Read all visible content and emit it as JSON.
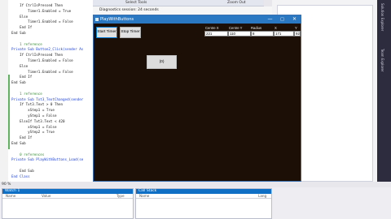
{
  "editor": {
    "lines": [
      {
        "text": "    If CtrlIsPressed Then",
        "cls": ""
      },
      {
        "text": "        Timer1.Enabled = True",
        "cls": ""
      },
      {
        "text": "    Else",
        "cls": ""
      },
      {
        "text": "        Timer1.Enabled = False",
        "cls": ""
      },
      {
        "text": "    End If",
        "cls": ""
      },
      {
        "text": "End Sub",
        "cls": ""
      },
      {
        "text": "",
        "cls": ""
      },
      {
        "text": "    1 reference",
        "cls": "cm"
      },
      {
        "text": "Private Sub Button2_Click(sender As",
        "cls": "kw"
      },
      {
        "text": "    If CtrlIsPressed Then",
        "cls": ""
      },
      {
        "text": "        Timer1.Enabled = False",
        "cls": ""
      },
      {
        "text": "    Else",
        "cls": ""
      },
      {
        "text": "        Timer1.Enabled = False",
        "cls": ""
      },
      {
        "text": "    End If",
        "cls": ""
      },
      {
        "text": "End Sub",
        "cls": ""
      },
      {
        "text": "",
        "cls": ""
      },
      {
        "text": "    1 reference",
        "cls": "cm"
      },
      {
        "text": "Private Sub Txt3_TextChanged(sender",
        "cls": "kw"
      },
      {
        "text": "    If Txt3.Text > 0 Then",
        "cls": ""
      },
      {
        "text": "        xStep1 = True",
        "cls": ""
      },
      {
        "text": "        yStep1 = False",
        "cls": ""
      },
      {
        "text": "    ElseIf Txt3.Text < 420",
        "cls": ""
      },
      {
        "text": "        xStep1 = False",
        "cls": ""
      },
      {
        "text": "        yStep2 = True",
        "cls": ""
      },
      {
        "text": "    End If",
        "cls": ""
      },
      {
        "text": "End Sub",
        "cls": ""
      },
      {
        "text": "",
        "cls": ""
      },
      {
        "text": "    0 references",
        "cls": "cm"
      },
      {
        "text": "Private Sub PlayWithButtons_Load(se",
        "cls": "kw"
      },
      {
        "text": "",
        "cls": ""
      },
      {
        "text": "    End Sub",
        "cls": ""
      },
      {
        "text": "End Class",
        "cls": "kw"
      }
    ],
    "zoom": "90 %"
  },
  "vs": {
    "toolbar": {
      "select_tools": "Select Tools",
      "zoom_out": "Zoom Out"
    },
    "diagnostics": "Diagnostics session: 24 seconds",
    "right_tabs": [
      "Solution Explorer",
      "Team Explorer"
    ],
    "bottom_panels": [
      {
        "title": "Watch 1",
        "cols": [
          "Name",
          "Value",
          "Type"
        ]
      },
      {
        "title": "Call Stack",
        "cols": [
          "Name",
          "Lang"
        ]
      }
    ]
  },
  "form": {
    "title": "PlayWithButtons",
    "buttons": {
      "start": "Start Timer",
      "stop": "Stop Timer",
      "ball": "(0)"
    },
    "fields": [
      {
        "label": "Centre X",
        "value": "221"
      },
      {
        "label": "Centre Y",
        "value": "110"
      },
      {
        "label": "Radius",
        "value": "8"
      },
      {
        "label": "X",
        "value": "171"
      },
      {
        "label": "Y",
        "value": "92"
      }
    ]
  }
}
